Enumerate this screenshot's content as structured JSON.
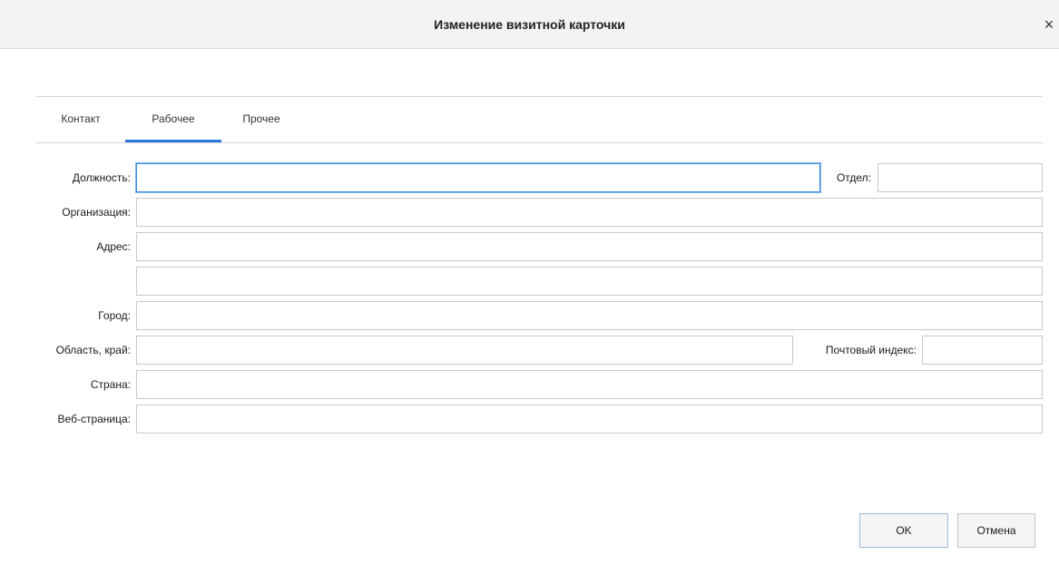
{
  "dialog": {
    "title": "Изменение визитной карточки",
    "close_glyph": "×"
  },
  "tabs": [
    {
      "label": "Контакт",
      "active": false
    },
    {
      "label": "Рабочее",
      "active": true
    },
    {
      "label": "Прочее",
      "active": false
    }
  ],
  "form": {
    "job_title": {
      "label": "Должность:",
      "value": ""
    },
    "department": {
      "label": "Отдел:",
      "value": ""
    },
    "organization": {
      "label": "Организация:",
      "value": ""
    },
    "address": {
      "label": "Адрес:",
      "value_line1": "",
      "value_line2": ""
    },
    "city": {
      "label": "Город:",
      "value": ""
    },
    "region": {
      "label": "Область, край:",
      "value": ""
    },
    "postal_code": {
      "label": "Почтовый индекс:",
      "value": ""
    },
    "country": {
      "label": "Страна:",
      "value": ""
    },
    "web_page": {
      "label": "Веб-страница:",
      "value": ""
    }
  },
  "buttons": {
    "ok": "OK",
    "cancel": "Отмена"
  },
  "colors": {
    "accent": "#2b79d6",
    "titlebar": "#f3f3f3"
  }
}
